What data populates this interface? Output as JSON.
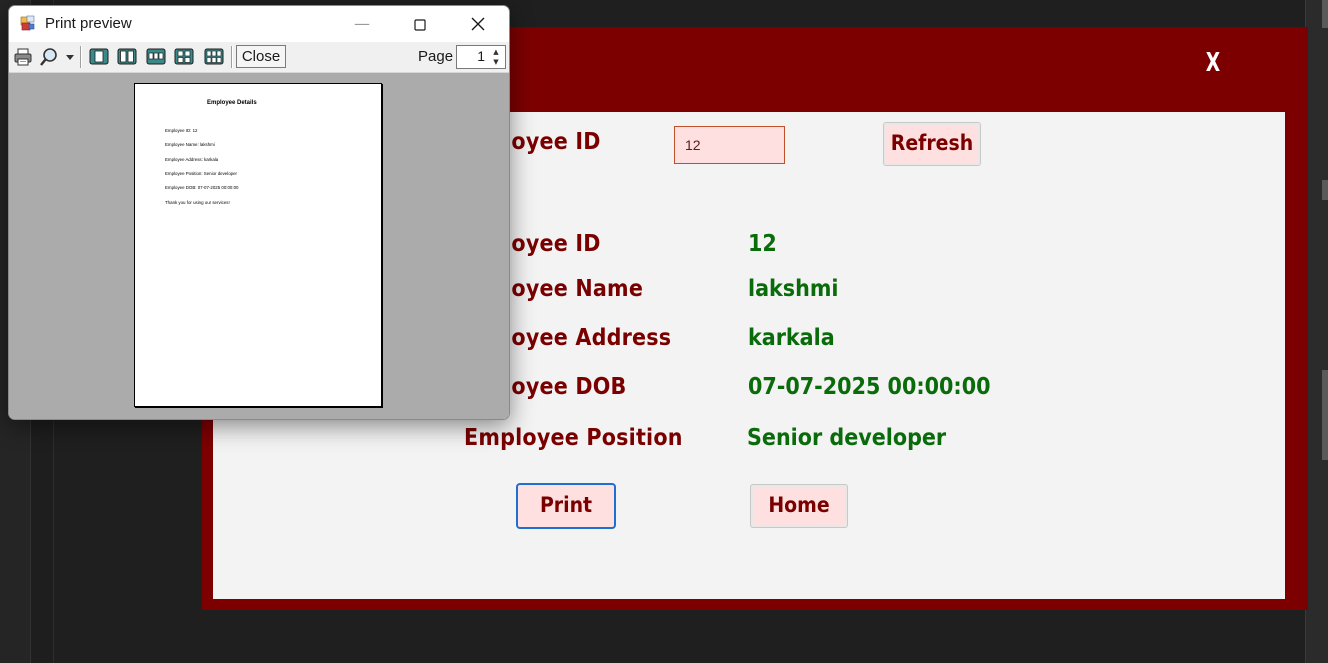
{
  "main_window": {
    "close_label": "X",
    "search_label": "Employee ID",
    "search_value": "12",
    "refresh_label": "Refresh",
    "fields": [
      {
        "label": "Employee ID",
        "value": "12"
      },
      {
        "label": "Employee Name",
        "value": "lakshmi"
      },
      {
        "label": "Employee Address",
        "value": "karkala"
      },
      {
        "label": "Employee DOB",
        "value": "07-07-2025 00:00:00"
      },
      {
        "label": "Employee Position",
        "value": "Senior developer"
      }
    ],
    "print_label": "Print",
    "home_label": "Home"
  },
  "print_preview": {
    "title": "Print preview",
    "toolbar": {
      "print_icon": "printer-icon",
      "zoom_icon": "zoom-icon",
      "page_layout_icons": [
        "one-page-icon",
        "two-pages-icon",
        "three-pages-icon",
        "four-pages-icon",
        "six-pages-icon"
      ],
      "close_label": "Close",
      "page_label": "Page",
      "page_value": "1"
    },
    "document": {
      "heading": "Employee Details",
      "lines": [
        "Employee ID: 12",
        "Employee Name: lakshmi",
        "Employee Address: karkala",
        "Employee Position: Senior developer",
        "Employee DOB: 07-07-2025 00:00:00",
        "Thank you for using our services!"
      ]
    }
  },
  "colors": {
    "window_frame": "#7d0000",
    "label_text": "#7a0000",
    "value_text": "#0a6b0a",
    "input_bg": "#ffe0e0"
  }
}
